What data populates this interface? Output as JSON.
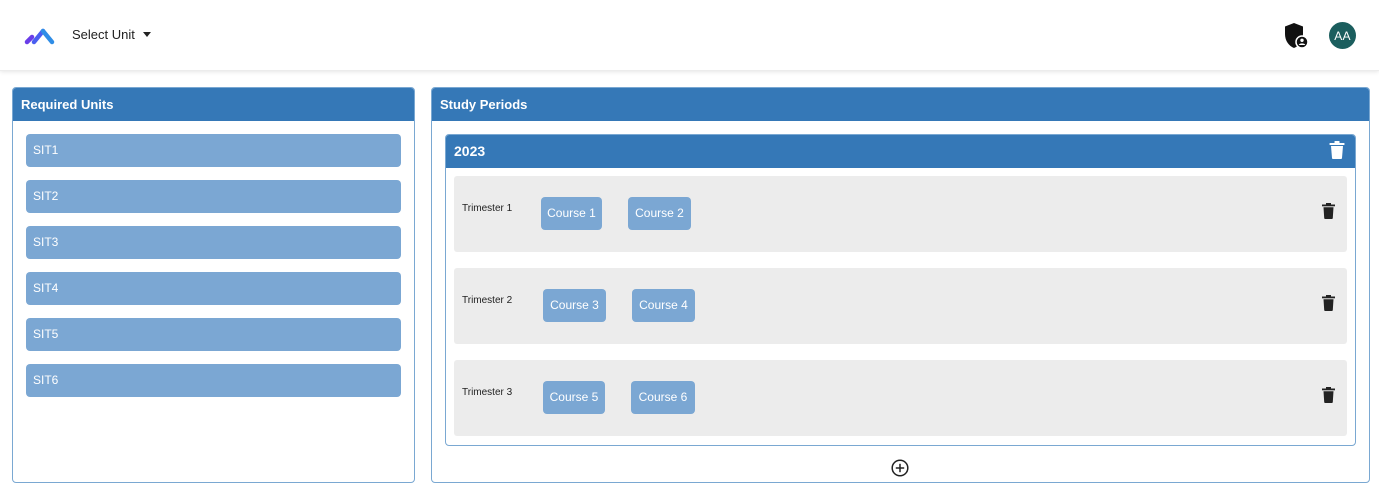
{
  "header": {
    "unit_select_label": "Select Unit",
    "avatar_initials": "AA"
  },
  "required_units": {
    "title": "Required Units",
    "items": [
      "SIT1",
      "SIT2",
      "SIT3",
      "SIT4",
      "SIT5",
      "SIT6"
    ]
  },
  "study_periods": {
    "title": "Study Periods",
    "years": [
      {
        "year": "2023",
        "trimesters": [
          {
            "label": "Trimester 1",
            "courses": [
              "Course 1",
              "Course 2"
            ]
          },
          {
            "label": "Trimester 2",
            "courses": [
              "Course 3",
              "Course 4"
            ]
          },
          {
            "label": "Trimester 3",
            "courses": [
              "Course 5",
              "Course 6"
            ]
          }
        ]
      }
    ]
  },
  "colors": {
    "panel_header": "#3578b7",
    "chip": "#7ba7d3",
    "trimester_bg": "#ececec",
    "avatar_bg": "#1b5e5e"
  },
  "icons": [
    "logo-icon",
    "caret-down-icon",
    "admin-shield-icon",
    "trash-icon",
    "add-circle-icon"
  ]
}
